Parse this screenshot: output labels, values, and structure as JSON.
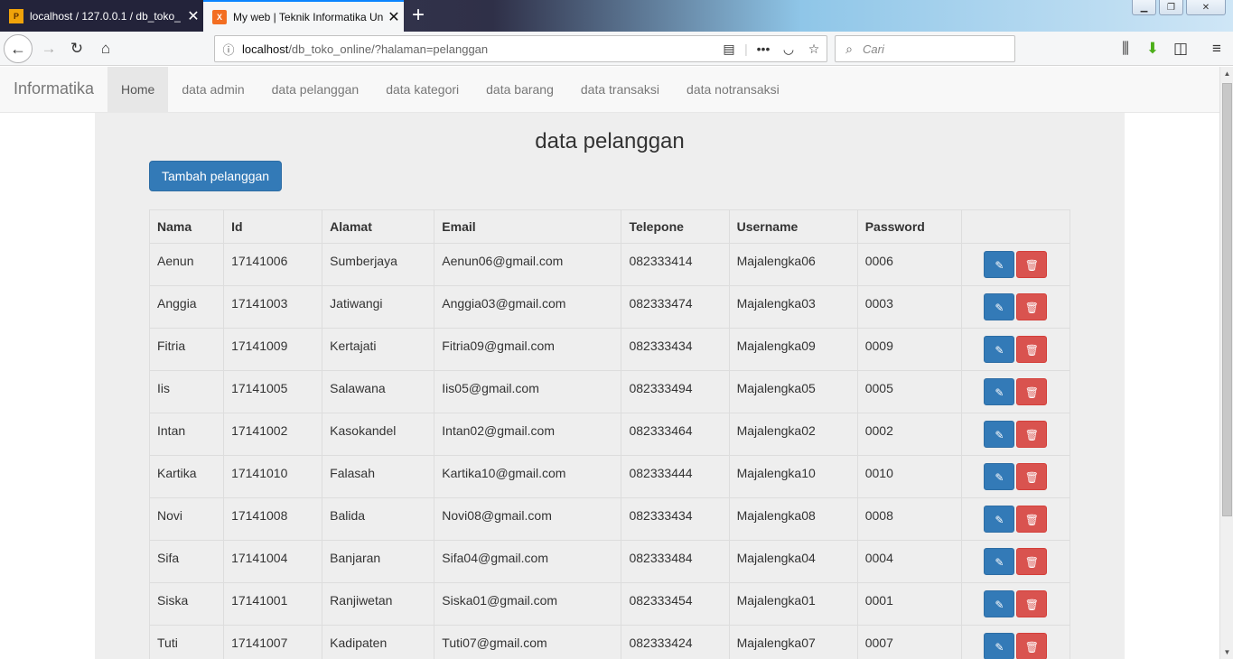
{
  "browser": {
    "tabs": [
      {
        "title": "localhost / 127.0.0.1 / db_toko_",
        "active": false
      },
      {
        "title": "My web | Teknik Informatika Un",
        "active": true
      }
    ],
    "url_host": "localhost",
    "url_path": "/db_toko_online/?halaman=pelanggan",
    "search_placeholder": "Cari"
  },
  "site": {
    "brand": "Informatika",
    "menu": [
      "Home",
      "data admin",
      "data pelanggan",
      "data kategori",
      "data barang",
      "data transaksi",
      "data notransaksi"
    ]
  },
  "main": {
    "title": "data pelanggan",
    "add_button": "Tambah pelanggan",
    "columns": [
      "Nama",
      "Id",
      "Alamat",
      "Email",
      "Telepone",
      "Username",
      "Password",
      ""
    ],
    "rows": [
      [
        "Aenun",
        "17141006",
        "Sumberjaya",
        "Aenun06@gmail.com",
        "082333414",
        "Majalengka06",
        "0006"
      ],
      [
        "Anggia",
        "17141003",
        "Jatiwangi",
        "Anggia03@gmail.com",
        "082333474",
        "Majalengka03",
        "0003"
      ],
      [
        "Fitria",
        "17141009",
        "Kertajati",
        "Fitria09@gmail.com",
        "082333434",
        "Majalengka09",
        "0009"
      ],
      [
        "Iis",
        "17141005",
        "Salawana",
        "Iis05@gmail.com",
        "082333494",
        "Majalengka05",
        "0005"
      ],
      [
        "Intan",
        "17141002",
        "Kasokandel",
        "Intan02@gmail.com",
        "082333464",
        "Majalengka02",
        "0002"
      ],
      [
        "Kartika",
        "17141010",
        "Falasah",
        "Kartika10@gmail.com",
        "082333444",
        "Majalengka10",
        "0010"
      ],
      [
        "Novi",
        "17141008",
        "Balida",
        "Novi08@gmail.com",
        "082333434",
        "Majalengka08",
        "0008"
      ],
      [
        "Sifa",
        "17141004",
        "Banjaran",
        "Sifa04@gmail.com",
        "082333484",
        "Majalengka04",
        "0004"
      ],
      [
        "Siska",
        "17141001",
        "Ranjiwetan",
        "Siska01@gmail.com",
        "082333454",
        "Majalengka01",
        "0001"
      ],
      [
        "Tuti",
        "17141007",
        "Kadipaten",
        "Tuti07@gmail.com",
        "082333424",
        "Majalengka07",
        "0007"
      ]
    ]
  },
  "colors": {
    "primary": "#337ab7",
    "danger": "#d9534f",
    "content_bg": "#eeeeee",
    "navbar_bg": "#f8f8f8"
  },
  "icons": {
    "edit": "edit-icon",
    "delete": "trash-icon"
  }
}
